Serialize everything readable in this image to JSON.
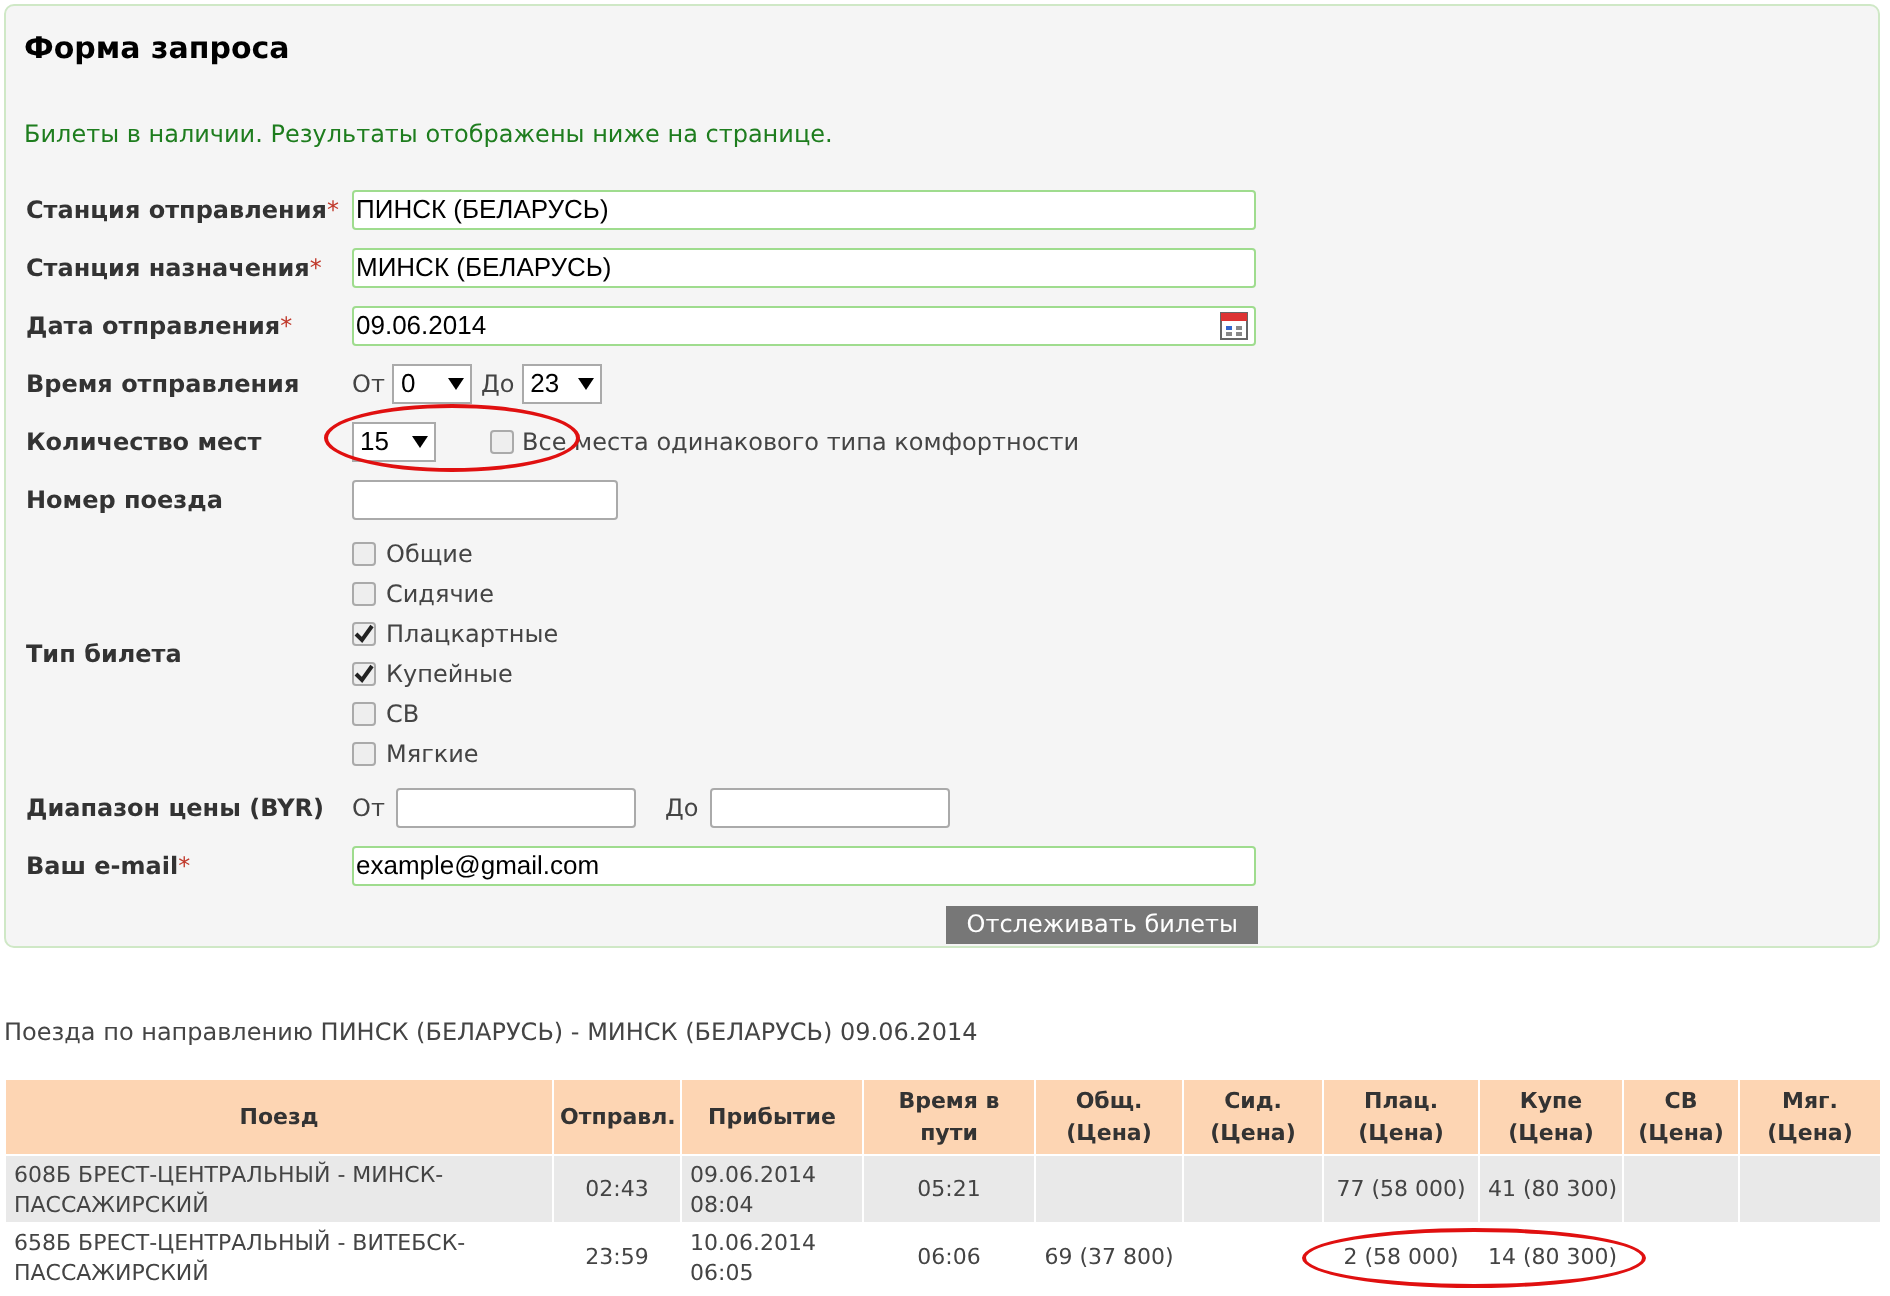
{
  "form": {
    "title": "Форма запроса",
    "notice": "Билеты в наличии. Результаты отображены ниже на странице.",
    "departure": {
      "label": "Станция отправления",
      "required_mark": "*",
      "value": "ПИНСК (БЕЛАРУСЬ)"
    },
    "arrival": {
      "label": "Станция назначения",
      "required_mark": "*",
      "value": "МИНСК (БЕЛАРУСЬ)"
    },
    "date": {
      "label": "Дата отправления",
      "required_mark": "*",
      "value": "09.06.2014"
    },
    "time": {
      "label": "Время отправления",
      "from_label": "От",
      "from_value": "0",
      "to_label": "До",
      "to_value": "23"
    },
    "seats": {
      "label": "Количество мест",
      "value": "15",
      "circled": true,
      "same_class": {
        "label": "Все места одинакового типа комфортности",
        "checked": false
      }
    },
    "train_number": {
      "label": "Номер поезда"
    },
    "ticket_type": {
      "label": "Тип билета",
      "options": [
        {
          "label": "Общие",
          "checked": false
        },
        {
          "label": "Сидячие",
          "checked": false
        },
        {
          "label": "Плацкартные",
          "checked": true
        },
        {
          "label": "Купейные",
          "checked": true
        },
        {
          "label": "СВ",
          "checked": false
        },
        {
          "label": "Мягкие",
          "checked": false
        }
      ]
    },
    "price": {
      "label": "Диапазон цены (BYR)",
      "from_label": "От",
      "to_label": "До"
    },
    "email": {
      "label": "Ваш e-mail",
      "required_mark": "*",
      "value": "example@gmail.com"
    },
    "submit": "Отслеживать билеты"
  },
  "results": {
    "title": "Поезда по направлению ПИНСК (БЕЛАРУСЬ) - МИНСК (БЕЛАРУСЬ) 09.06.2014",
    "columns": [
      "Поезд",
      "Отправл.",
      "Прибытие",
      "Время в пути",
      "Общ. (Цена)",
      "Сид. (Цена)",
      "Плац. (Цена)",
      "Купе (Цена)",
      "СВ (Цена)",
      "Мяг. (Цена)"
    ],
    "rows": [
      {
        "circled": false,
        "cells": [
          "608Б БРЕСТ-ЦЕНТРАЛЬНЫЙ - МИНСК-ПАССАЖИРСКИЙ",
          "02:43",
          "09.06.2014 08:04",
          "05:21",
          "",
          "",
          "77 (58 000)",
          "41 (80 300)",
          "",
          ""
        ]
      },
      {
        "circled": true,
        "cells": [
          "658Б БРЕСТ-ЦЕНТРАЛЬНЫЙ - ВИТЕБСК-ПАССАЖИРСКИЙ",
          "23:59",
          "10.06.2014 06:05",
          "06:06",
          "69 (37 800)",
          "",
          "2 (58 000)",
          "14 (80 300)",
          "",
          ""
        ]
      }
    ]
  }
}
